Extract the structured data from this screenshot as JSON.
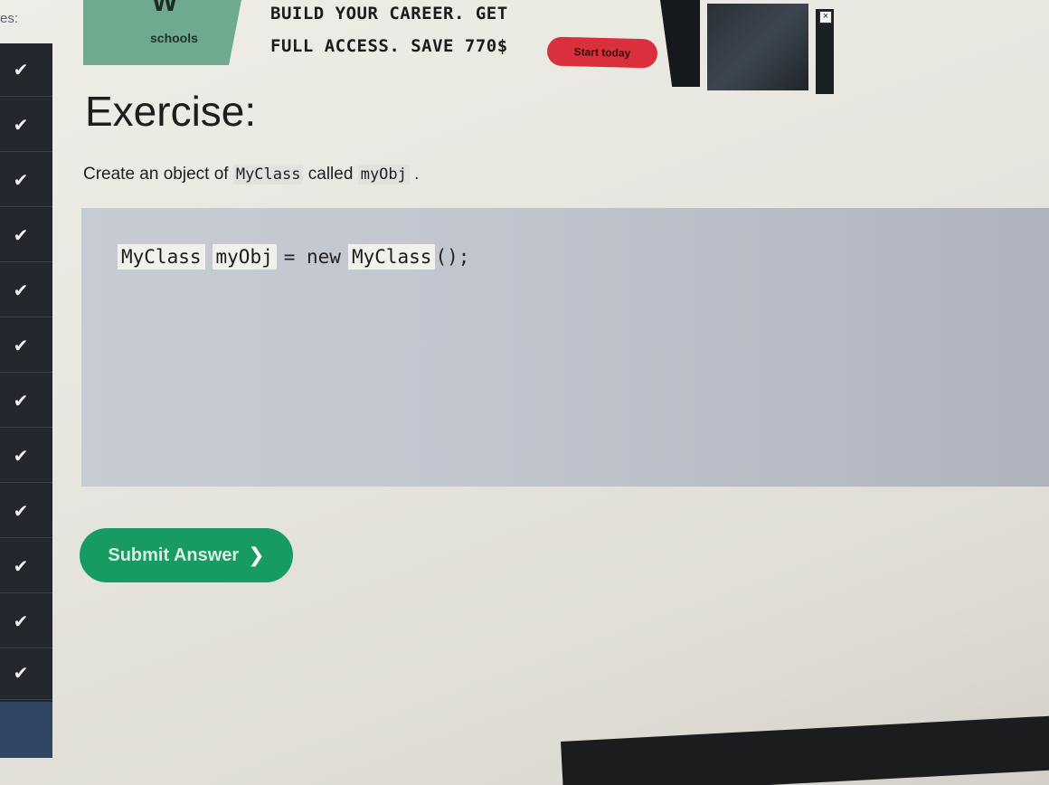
{
  "sidebar": {
    "top_label": "es:",
    "check_glyph": "✔",
    "items": [
      {
        "id": 1,
        "icon": "check-icon"
      },
      {
        "id": 2,
        "icon": "check-icon"
      },
      {
        "id": 3,
        "icon": "check-icon"
      },
      {
        "id": 4,
        "icon": "check-icon"
      },
      {
        "id": 5,
        "icon": "check-icon"
      },
      {
        "id": 6,
        "icon": "check-icon"
      },
      {
        "id": 7,
        "icon": "check-icon"
      },
      {
        "id": 8,
        "icon": "check-icon"
      },
      {
        "id": 9,
        "icon": "check-icon"
      },
      {
        "id": 10,
        "icon": "check-icon"
      },
      {
        "id": 11,
        "icon": "check-icon"
      },
      {
        "id": 12,
        "icon": "check-icon"
      }
    ]
  },
  "ad": {
    "logo_letters": "W",
    "logo_text": "schools",
    "headline_line1": "BUILD YOUR CAREER. GET",
    "headline_line2": "FULL ACCESS. SAVE 770$",
    "cta_label": "Start today",
    "close_glyph": "×",
    "cta_color": "#d9303c",
    "logo_color": "#6fa98e"
  },
  "exercise": {
    "title": "Exercise:",
    "instruction_prefix": "Create an object of",
    "instruction_class": "MyClass",
    "instruction_middle": "called",
    "instruction_obj": "myObj",
    "instruction_suffix": ".",
    "code": {
      "input1_value": "MyClass",
      "input2_value": "myObj",
      "text_equals_new": "= new",
      "input3_value": "MyClass",
      "text_tail": "();"
    },
    "submit_label": "Submit Answer",
    "submit_icon": "chevron-right-icon",
    "submit_glyph": "❯",
    "submit_color": "#179b63"
  }
}
